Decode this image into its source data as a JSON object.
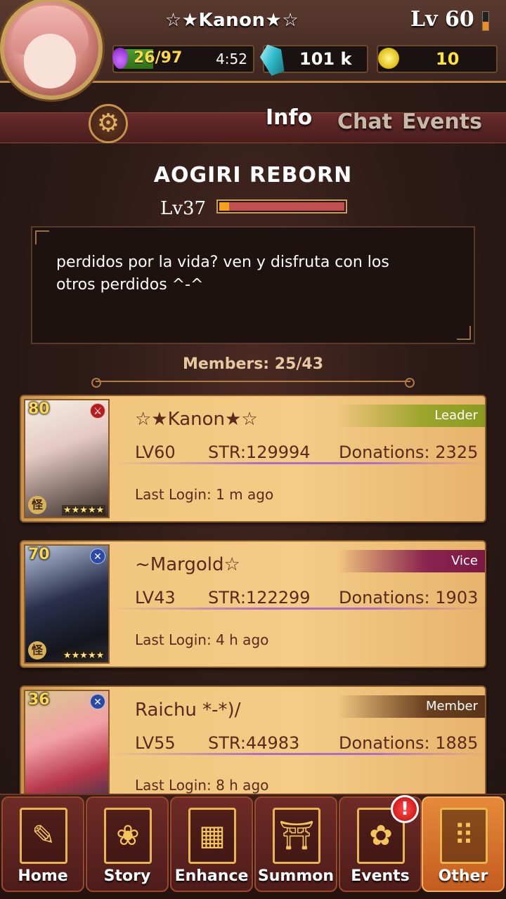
{
  "player": {
    "name": "☆★Kanon★☆",
    "level": "Lv 60",
    "stamina": "26/97",
    "stamina_fill": 0.27,
    "timer": "4:52",
    "crystals": "101 k",
    "coins": "10"
  },
  "tabs": {
    "info": "Info",
    "chat": "Chat",
    "events": "Events"
  },
  "guild": {
    "name": "AOGIRI REBORN",
    "level": "Lv37",
    "xp_fraction": 0.08,
    "description_line1": "perdidos por la vida? ven y disfruta con los",
    "description_line2": "otros perdidos ^-^",
    "members": "Members: 25/43"
  },
  "members": [
    {
      "portrait_level": "80",
      "type_icon": "sword-icon",
      "rarity_icon": "怪",
      "stars": "★★★★★",
      "name": "☆★Kanon★☆",
      "role": "Leader",
      "lv": "LV60",
      "str": "STR:129994",
      "donations": "Donations: 2325",
      "last_login": "Last Login: 1 m ago"
    },
    {
      "portrait_level": "70",
      "type_icon": "cross-icon",
      "rarity_icon": "怪",
      "stars": "★★★★★",
      "name": "~Margold☆",
      "role": "Vice",
      "lv": "LV43",
      "str": "STR:122299",
      "donations": "Donations: 1903",
      "last_login": "Last Login: 4 h ago"
    },
    {
      "portrait_level": "36",
      "type_icon": "cross-icon",
      "rarity_icon": "",
      "stars": "",
      "name": "Raichu *-*)/",
      "role": "Member",
      "lv": "LV55",
      "str": "STR:44983",
      "donations": "Donations: 1885",
      "last_login": "Last Login: 8 h ago"
    }
  ],
  "nav": {
    "home": "Home",
    "story": "Story",
    "enhance": "Enhance",
    "summon": "Summon",
    "events": "Events",
    "events_badge": "!",
    "other": "Other"
  },
  "colors": {
    "accent_gold": "#c9a25a",
    "card_gold": "#f2c67e",
    "active_nav": "#e68a3a",
    "leader_tag": "#9aa52a",
    "vice_tag": "#8a2450",
    "member_tag": "#6a4020"
  }
}
